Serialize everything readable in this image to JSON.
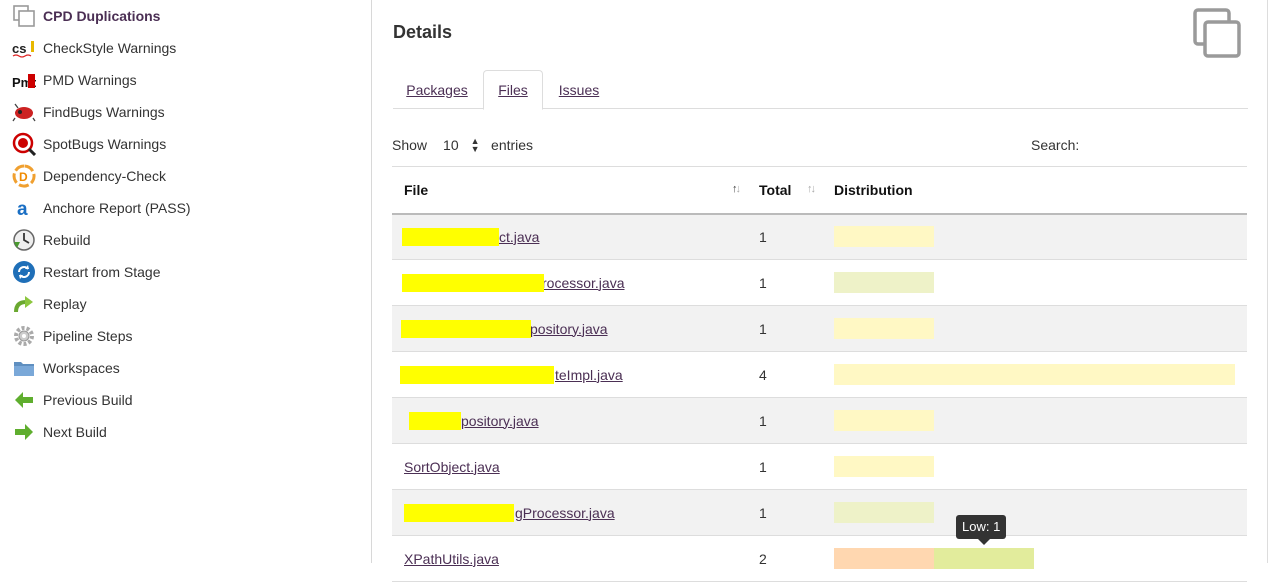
{
  "sidebar": {
    "items": [
      {
        "label": "CPD Duplications",
        "icon": "cpd-duplications-icon",
        "active": true
      },
      {
        "label": "CheckStyle Warnings",
        "icon": "checkstyle-icon"
      },
      {
        "label": "PMD Warnings",
        "icon": "pmd-icon"
      },
      {
        "label": "FindBugs Warnings",
        "icon": "findbugs-icon"
      },
      {
        "label": "SpotBugs Warnings",
        "icon": "spotbugs-icon"
      },
      {
        "label": "Dependency-Check",
        "icon": "dependency-check-icon"
      },
      {
        "label": "Anchore Report (PASS)",
        "icon": "anchore-icon"
      },
      {
        "label": "Rebuild",
        "icon": "rebuild-icon"
      },
      {
        "label": "Restart from Stage",
        "icon": "restart-icon"
      },
      {
        "label": "Replay",
        "icon": "replay-icon"
      },
      {
        "label": "Pipeline Steps",
        "icon": "gear-icon"
      },
      {
        "label": "Workspaces",
        "icon": "folder-icon"
      },
      {
        "label": "Previous Build",
        "icon": "arrow-left-icon"
      },
      {
        "label": "Next Build",
        "icon": "arrow-right-icon"
      }
    ]
  },
  "main": {
    "title": "Details",
    "tabs": [
      {
        "label": "Packages"
      },
      {
        "label": "Files",
        "active": true
      },
      {
        "label": "Issues"
      }
    ],
    "show_label": "Show",
    "entries_value": "10",
    "entries_label": "entries",
    "search_label": "Search:",
    "table": {
      "headers": [
        "File",
        "Total",
        "Distribution"
      ],
      "rows": [
        {
          "file": "ct.java",
          "total": "1"
        },
        {
          "file": "rocessor.java",
          "total": "1"
        },
        {
          "file": "pository.java",
          "total": "1"
        },
        {
          "file": "teImpl.java",
          "total": "4"
        },
        {
          "file": "pository.java",
          "total": "1"
        },
        {
          "file": "SortObject.java",
          "total": "1"
        },
        {
          "file": "gProcessor.java",
          "total": "1"
        },
        {
          "file": "XPathUtils.java",
          "total": "2"
        }
      ]
    },
    "tooltip": "Low: 1"
  },
  "colors": {
    "low_yellow": "#fff8c4",
    "low_green": "#eef2c8",
    "orange": "#ffd7b0",
    "green_hover": "#e2ec9c",
    "redaction": "#ffff00",
    "link": "#4b2f54"
  }
}
